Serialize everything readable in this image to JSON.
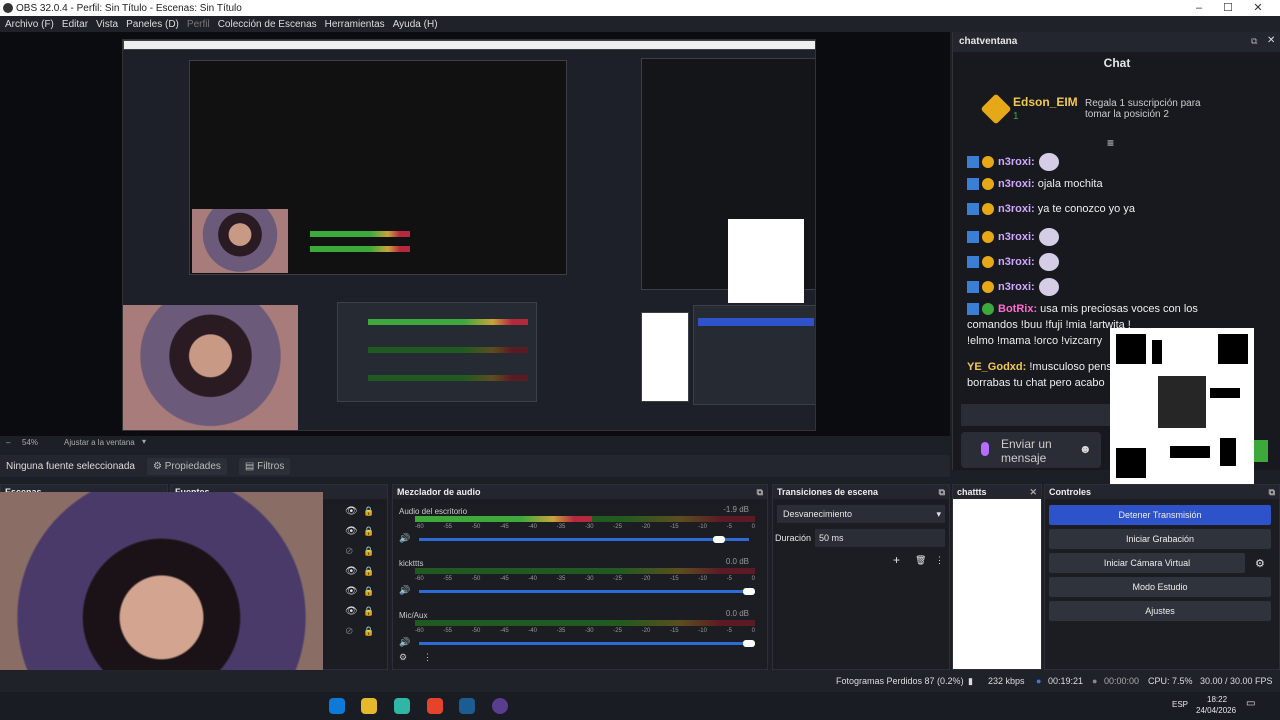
{
  "window": {
    "title": "OBS 32.0.4 - Perfil: Sin Título - Escenas: Sin Título",
    "min": "–",
    "max": "☐",
    "close": "✕"
  },
  "menu": [
    "Archivo (F)",
    "Editar",
    "Vista",
    "Paneles (D)",
    "Perfil",
    "Colección de Escenas",
    "Herramientas",
    "Ayuda (H)"
  ],
  "zoom": {
    "value": "54%",
    "fit": "Ajustar a la ventana"
  },
  "source_bar": {
    "none": "Ninguna fuente seleccionada",
    "properties": "Propiedades",
    "filters": "Filtros"
  },
  "chat_panel": {
    "dock_title": "chatventana",
    "title": "Chat",
    "hype": {
      "user": "Edson_EIM",
      "count": "1",
      "message": "Regala 1 suscripción para tomar la posición 2"
    },
    "lines": [
      {
        "user": "n3roxi:",
        "text": "",
        "emote": true
      },
      {
        "user": "n3roxi:",
        "text": "ojala mochita",
        "emote": false
      },
      {
        "user": "n3roxi:",
        "text": "ya te conozco yo ya",
        "emote": false
      },
      {
        "user": "n3roxi:",
        "text": "",
        "emote": true
      },
      {
        "user": "n3roxi:",
        "text": "",
        "emote": true
      },
      {
        "user": "n3roxi:",
        "text": "",
        "emote": true
      }
    ],
    "botrix_user": "BotRix:",
    "botrix_text1": "usa mis preciosas voces con los",
    "botrix_text2": "comandos !buu !fuji !mia !artwita !",
    "botrix_text3": "!elmo !mama !orco !vizcarry",
    "ye_user": "YE_Godxd:",
    "ye_text1": "!musculoso pens",
    "ye_text2": "borrabas tu chat pero acabo",
    "send_placeholder": "Enviar un mensaje"
  },
  "docks": {
    "scenes": "Escenas",
    "sources": "Fuentes",
    "mixer": "Mezclador de audio",
    "transitions": "Transiciones de escena",
    "chatts": "chattts",
    "controls": "Controles"
  },
  "mixer": {
    "channels": [
      {
        "name": "Audio del escritorio",
        "db": "-1.9 dB",
        "level": 0.52,
        "vol": 0.91
      },
      {
        "name": "kickttts",
        "db": "0.0 dB",
        "level": 0.0,
        "vol": 1.0
      },
      {
        "name": "Mic/Aux",
        "db": "0.0 dB",
        "level": 0.0,
        "vol": 1.0
      }
    ],
    "ticks": [
      "-60",
      "-55",
      "-50",
      "-45",
      "-40",
      "-35",
      "-30",
      "-25",
      "-20",
      "-15",
      "-10",
      "-5",
      "0"
    ]
  },
  "transitions": {
    "selected": "Desvanecimiento",
    "duration_label": "Duración",
    "duration_value": "50 ms"
  },
  "controls": {
    "stop_stream": "Detener Transmisión",
    "start_record": "Iniciar Grabación",
    "start_vcam": "Iniciar Cámara Virtual",
    "studio_mode": "Modo Estudio",
    "settings": "Ajustes"
  },
  "status": {
    "dropped": "Fotogramas Perdidos 87 (0.2%)",
    "kbps": "232 kbps",
    "stream_time": "00:19:21",
    "rec_time": "00:00:00",
    "cpu": "CPU: 7.5%",
    "fps": "30.00 / 30.00 FPS"
  },
  "taskbar": {
    "lang": "ESP",
    "time": "18:22",
    "date": "24/04/2026"
  },
  "colors": {
    "accent": "#2d52c9",
    "green": "#3da93b",
    "yellow": "#e6a817"
  }
}
